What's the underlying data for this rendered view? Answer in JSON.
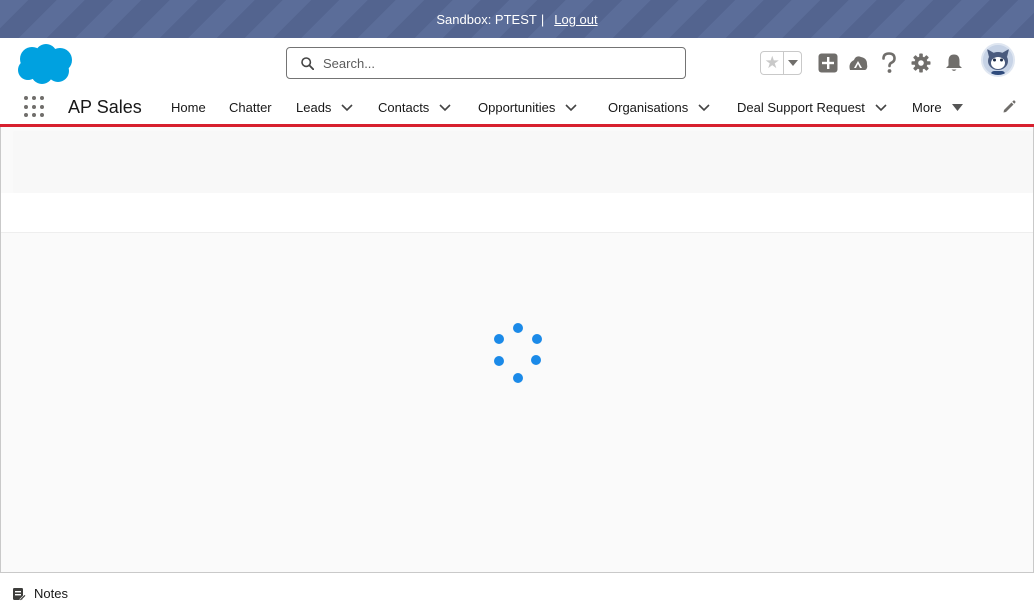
{
  "sandbox": {
    "text": "Sandbox: PTEST",
    "separator": "|",
    "logout_label": "Log out"
  },
  "header": {
    "logo_icon": "salesforce-cloud-icon",
    "search": {
      "placeholder": "Search...",
      "value": ""
    },
    "icons": [
      "star-icon",
      "chevron-down-icon",
      "add-icon",
      "trailhead-icon",
      "help-icon",
      "gear-icon",
      "bell-icon",
      "avatar"
    ]
  },
  "nav": {
    "app_name": "AP Sales",
    "items": [
      {
        "label": "Home",
        "has_menu": false
      },
      {
        "label": "Chatter",
        "has_menu": false
      },
      {
        "label": "Leads",
        "has_menu": true
      },
      {
        "label": "Contacts",
        "has_menu": true
      },
      {
        "label": "Opportunities",
        "has_menu": true
      },
      {
        "label": "Organisations",
        "has_menu": true
      },
      {
        "label": "Deal Support Request",
        "has_menu": true
      },
      {
        "label": "More",
        "has_menu": true
      }
    ]
  },
  "main": {
    "state": "loading",
    "spinner_icon": "loading-spinner-icon"
  },
  "utility": {
    "notes_label": "Notes"
  },
  "colors": {
    "accent": "#d7202e",
    "brand": "#00a1e0",
    "spinner": "#1b8ae8",
    "sandbox_bg": "#5b6d99"
  }
}
